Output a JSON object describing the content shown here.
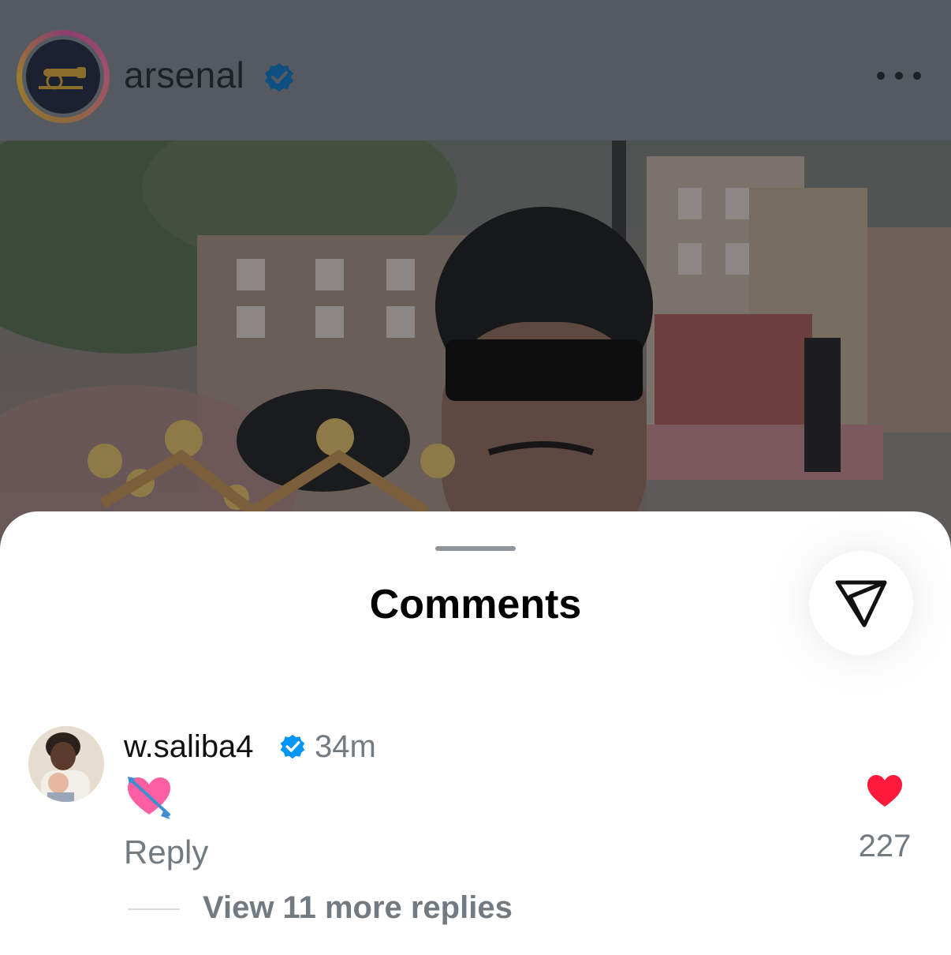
{
  "post": {
    "username": "arsenal",
    "avatar_icon": "cannon-logo-icon",
    "verified_icon": "verified-badge-icon",
    "more_icon": "more-horizontal-icon"
  },
  "comments_sheet": {
    "title": "Comments",
    "share_icon": "send-paper-plane-icon",
    "comment": {
      "username": "w.saliba4",
      "time": "34m",
      "text_emoji": "💘",
      "reply_label": "Reply",
      "like_count": "227",
      "liked": true,
      "like_color": "#ff1a3c",
      "view_replies_label": "View 11 more replies"
    }
  },
  "colors": {
    "verified_blue": "#0095f6",
    "secondary_text": "#737b82"
  }
}
